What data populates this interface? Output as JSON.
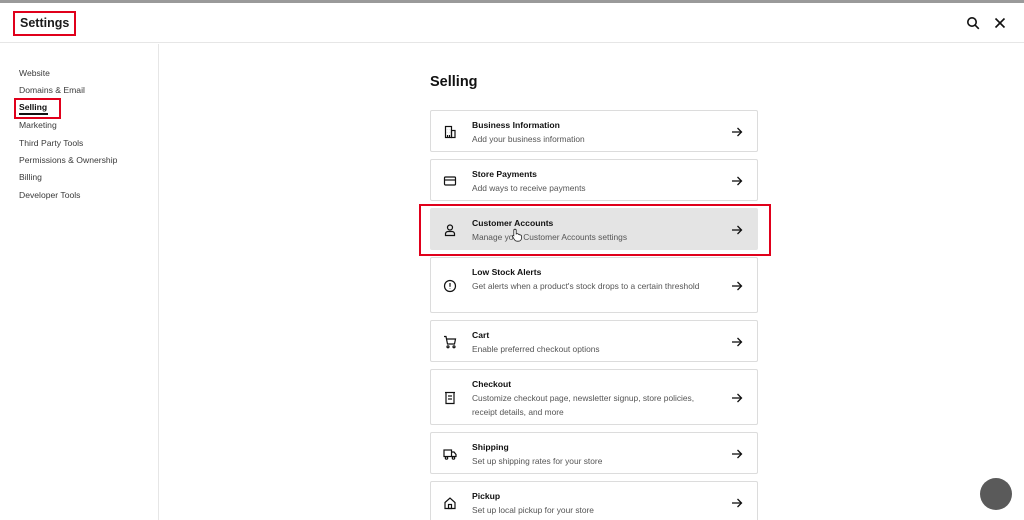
{
  "header": {
    "title": "Settings",
    "search_icon": "search-icon",
    "close_icon": "close-icon"
  },
  "sidebar": {
    "items": [
      {
        "label": "Website",
        "active": false
      },
      {
        "label": "Domains & Email",
        "active": false
      },
      {
        "label": "Selling",
        "active": true
      },
      {
        "label": "Marketing",
        "active": false
      },
      {
        "label": "Third Party Tools",
        "active": false
      },
      {
        "label": "Permissions & Ownership",
        "active": false
      },
      {
        "label": "Billing",
        "active": false
      },
      {
        "label": "Developer Tools",
        "active": false
      }
    ]
  },
  "main": {
    "title": "Selling",
    "cards": [
      {
        "icon": "building-icon",
        "title": "Business Information",
        "description": "Add your business information",
        "highlighted": false
      },
      {
        "icon": "credit-card-icon",
        "title": "Store Payments",
        "description": "Add ways to receive payments",
        "highlighted": false
      },
      {
        "icon": "user-icon",
        "title": "Customer Accounts",
        "description": "Manage your Customer Accounts settings",
        "highlighted": true
      },
      {
        "icon": "alert-circle-icon",
        "title": "Low Stock Alerts",
        "description": "Get alerts when a product's stock drops to a certain threshold",
        "highlighted": false
      },
      {
        "icon": "cart-icon",
        "title": "Cart",
        "description": "Enable preferred checkout options",
        "highlighted": false
      },
      {
        "icon": "receipt-icon",
        "title": "Checkout",
        "description": "Customize checkout page, newsletter signup, store policies, receipt details, and more",
        "highlighted": false
      },
      {
        "icon": "truck-icon",
        "title": "Shipping",
        "description": "Set up shipping rates for your store",
        "highlighted": false
      },
      {
        "icon": "home-icon",
        "title": "Pickup",
        "description": "Set up local pickup for your store",
        "highlighted": false
      }
    ]
  },
  "colors": {
    "annotation": "#e0001b",
    "highlight_bg": "#e4e4e4"
  }
}
